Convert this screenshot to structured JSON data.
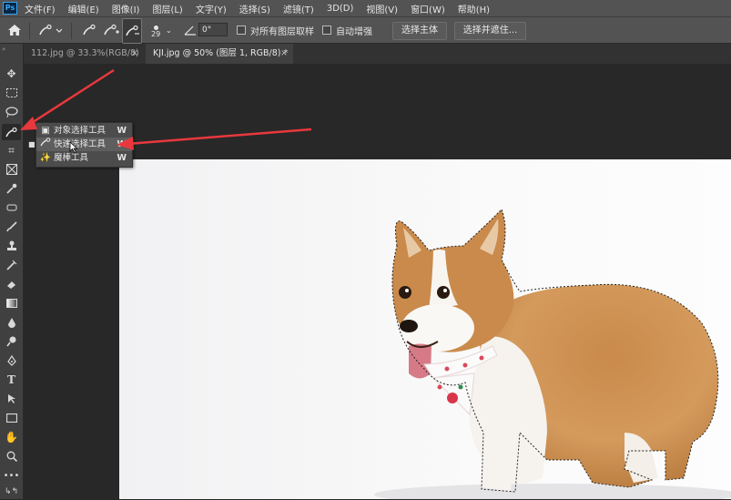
{
  "app": {
    "logo": "Ps"
  },
  "menu": [
    "文件(F)",
    "编辑(E)",
    "图像(I)",
    "图层(L)",
    "文字(Y)",
    "选择(S)",
    "滤镜(T)",
    "3D(D)",
    "视图(V)",
    "窗口(W)",
    "帮助(H)"
  ],
  "options": {
    "brush_size": "29",
    "angle_value": "0°",
    "sample_all_layers": "对所有图层取样",
    "auto_enhance": "自动增强",
    "select_subject": "选择主体",
    "select_and_mask": "选择并遮住..."
  },
  "tabs": [
    {
      "label": "112.jpg @ 33.3%(RGB/8)",
      "close": "×"
    },
    {
      "label": "KJI.jpg @ 50% (图层 1, RGB/8) *",
      "close": "×"
    }
  ],
  "flyout": {
    "items": [
      {
        "label": "对象选择工具",
        "key": "W",
        "icon": "object-selection-icon"
      },
      {
        "label": "快速选择工具",
        "key": "W",
        "icon": "quick-selection-icon"
      },
      {
        "label": "魔棒工具",
        "key": "W",
        "icon": "magic-wand-icon"
      }
    ]
  },
  "colors": {
    "arrow_red": "#e8383d",
    "panel_bg": "#535353",
    "canvas_bg": "#282828",
    "accent": "#31a8ff"
  }
}
